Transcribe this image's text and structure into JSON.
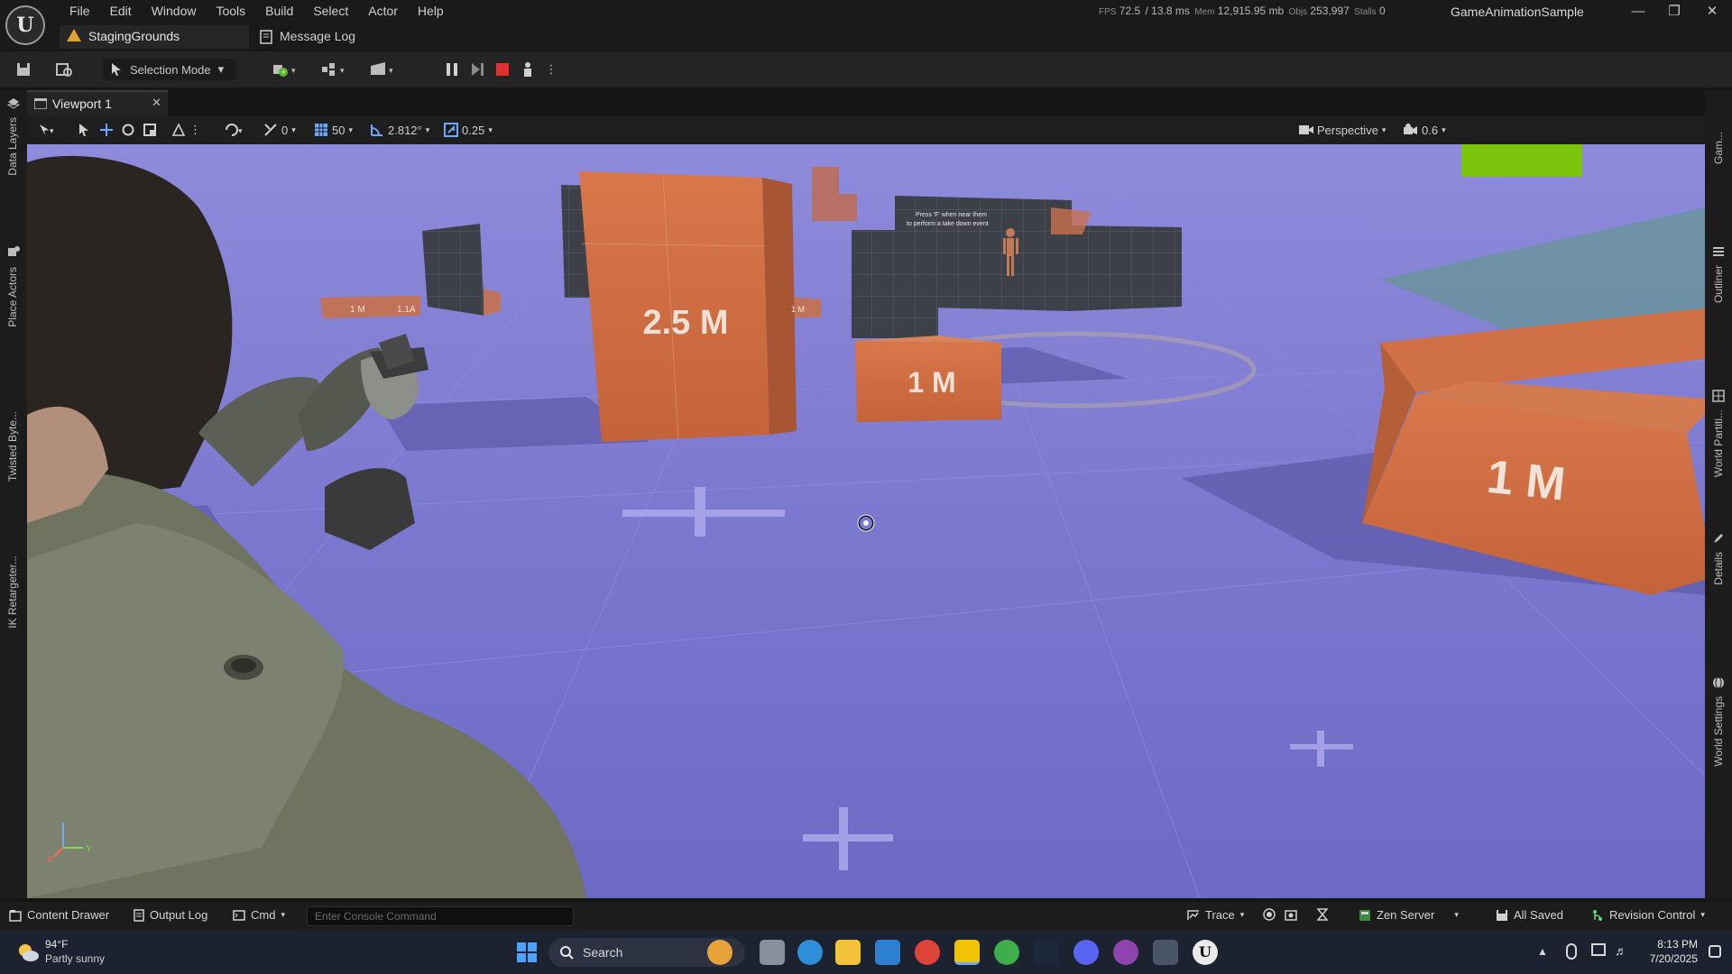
{
  "menu": [
    "File",
    "Edit",
    "Window",
    "Tools",
    "Build",
    "Select",
    "Actor",
    "Help"
  ],
  "stats": {
    "fps_label": "FPS",
    "fps": "72.5",
    "frame_time": "/ 13.8 ms",
    "mem_label": "Mem",
    "mem": "12,915.95 mb",
    "objs_label": "Objs",
    "objs": "253,997",
    "stalls_label": "Stalls",
    "stalls": "0"
  },
  "project_name": "GameAnimationSample",
  "tabs": {
    "level": "StagingGrounds",
    "message_log": "Message Log"
  },
  "toolbar": {
    "selection_mode": "Selection Mode"
  },
  "viewport": {
    "tab_label": "Viewport 1",
    "rot_snap": "0",
    "grid_snap": "50",
    "angle_snap": "2.812°",
    "scale_snap": "0.25",
    "view_mode": "Perspective",
    "camera_speed": "0.6",
    "signs": {
      "big": "2.5 M",
      "center": "1 M",
      "right": "1 M",
      "small_left_1": "1 M",
      "small_left_2": "1.1A",
      "small_mid": "1 M"
    },
    "hint_text": "Press 'F' when near them to perform a take down event"
  },
  "left_rail": [
    "Data Layers",
    "Place Actors",
    "Twisted Byte...",
    "IK Retargeter..."
  ],
  "right_rail": [
    "Gam...",
    "Outliner",
    "World Partiti...",
    "Details",
    "World Settings"
  ],
  "bottom": {
    "content_drawer": "Content Drawer",
    "output_log": "Output Log",
    "cmd": "Cmd",
    "console_placeholder": "Enter Console Command",
    "trace": "Trace",
    "zen_server": "Zen Server",
    "all_saved": "All Saved",
    "revision_control": "Revision Control"
  },
  "taskbar": {
    "weather_temp": "94°F",
    "weather_desc": "Partly sunny",
    "search": "Search",
    "time": "8:13 PM",
    "date": "7/20/2025"
  }
}
